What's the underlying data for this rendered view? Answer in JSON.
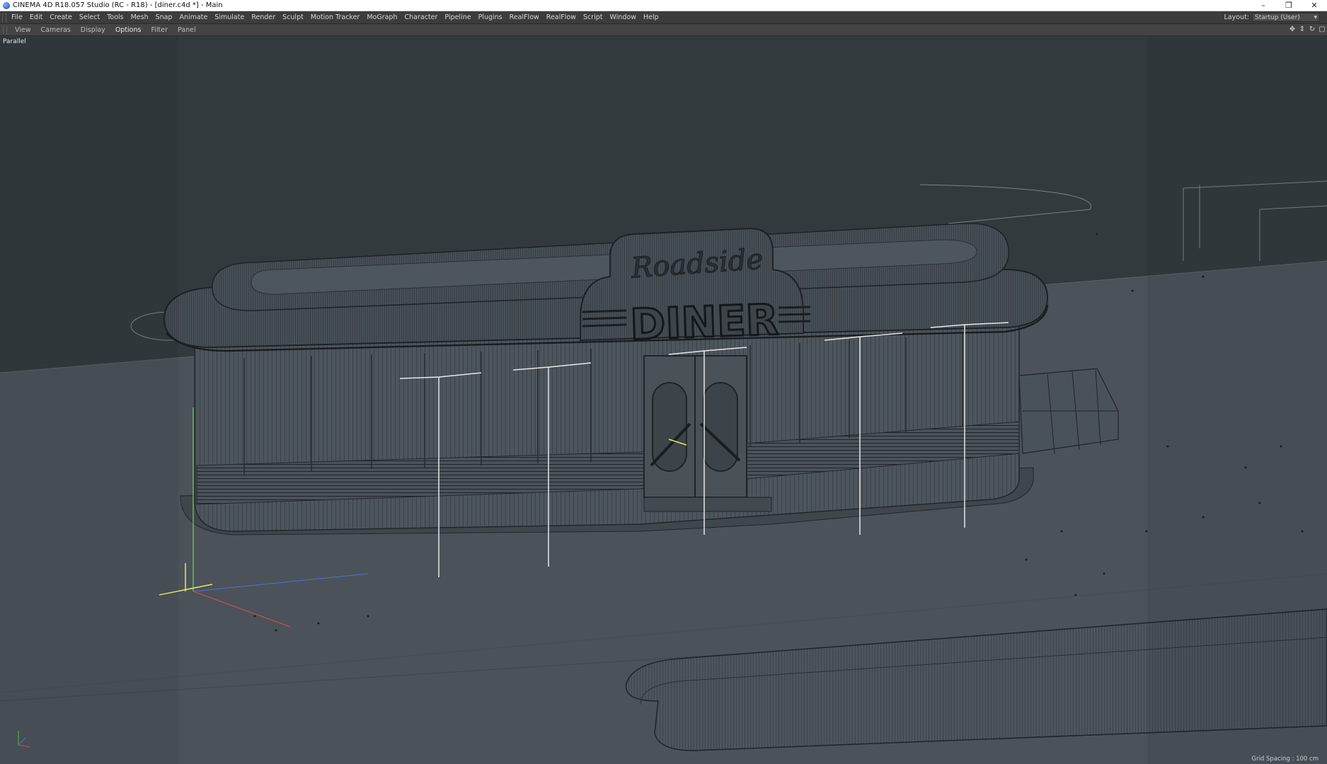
{
  "window": {
    "title": "CINEMA 4D R18.057 Studio (RC - R18) - [diner.c4d *] - Main",
    "minimize": "–",
    "restore": "❐",
    "close": "✕"
  },
  "menubar": {
    "items": [
      "File",
      "Edit",
      "Create",
      "Select",
      "Tools",
      "Mesh",
      "Snap",
      "Animate",
      "Simulate",
      "Render",
      "Sculpt",
      "Motion Tracker",
      "MoGraph",
      "Character",
      "Pipeline",
      "Plugins",
      "RealFlow",
      "RealFlow",
      "Script",
      "Window",
      "Help"
    ],
    "layout_label": "Layout:",
    "layout_value": "Startup (User)"
  },
  "viewport_menu": {
    "items": [
      "View",
      "Cameras",
      "Display",
      "Options",
      "Filter",
      "Panel"
    ],
    "active": "Options"
  },
  "viewport": {
    "camera_label": "Parallel",
    "grid_spacing": "Grid Spacing : 100 cm",
    "sign_top": "Roadside",
    "sign_main": "DINER"
  },
  "colors": {
    "menubar_bg": "#3c3c3c",
    "viewport_sky": "#333a3e",
    "viewport_ground": "#4b5259",
    "model_wire": "#22272b",
    "axis_y": "#5fbf4a",
    "axis_x": "#d85050",
    "axis_z": "#5070d8",
    "highlight": "#ffffff"
  },
  "icons": [
    "app-logo-icon",
    "move-view-icon",
    "zoom-view-icon",
    "rotate-view-icon",
    "maximize-view-icon"
  ]
}
